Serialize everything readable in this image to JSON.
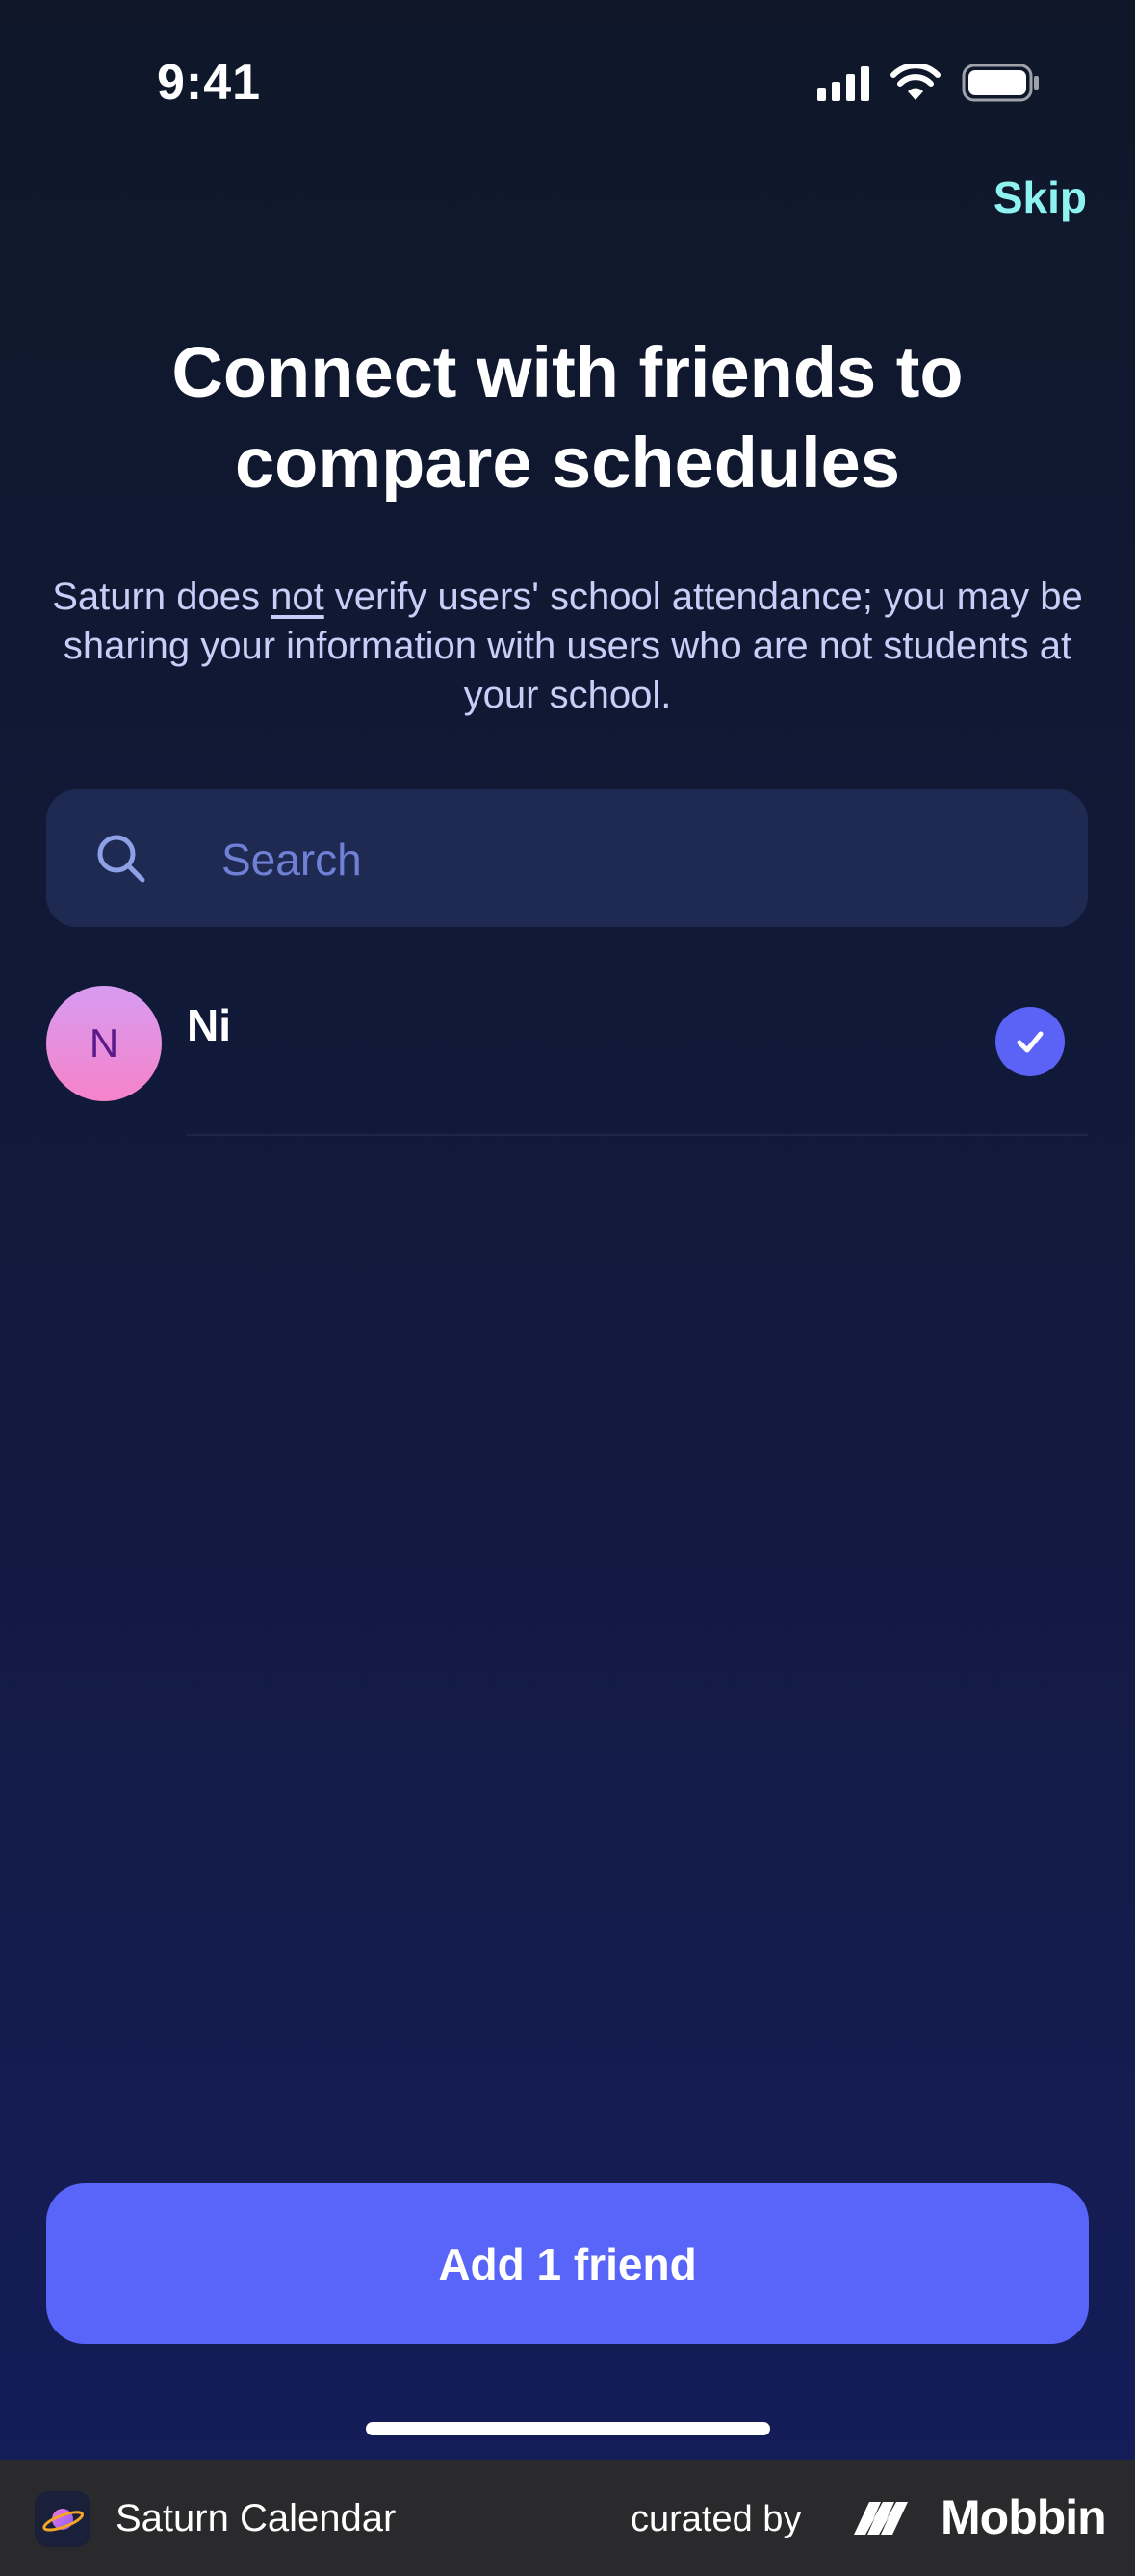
{
  "status_bar": {
    "time": "9:41",
    "icons": [
      "signal-icon",
      "wifi-icon",
      "battery-icon"
    ]
  },
  "header": {
    "skip_label": "Skip"
  },
  "main": {
    "title_line1": "Connect with friends to",
    "title_line2": "compare schedules",
    "disclaimer": {
      "part1": "Saturn does ",
      "emphasis": "not",
      "part2": " verify users' school attendance; you may be sharing your information with users who are not students at your school."
    }
  },
  "search": {
    "placeholder": "Search",
    "icon": "search-icon"
  },
  "friends": [
    {
      "initial": "N",
      "name": "Ni",
      "selected": true
    }
  ],
  "actions": {
    "add_label": "Add 1 friend"
  },
  "footer": {
    "app_name": "Saturn Calendar",
    "curated_by": "curated by",
    "brand": "Mobbin"
  },
  "colors": {
    "accent": "#5865f8",
    "skip": "#8ef3f0",
    "search_bg": "#1f2a52",
    "avatar_gradient": [
      "#d79cf2",
      "#f682c9"
    ]
  }
}
